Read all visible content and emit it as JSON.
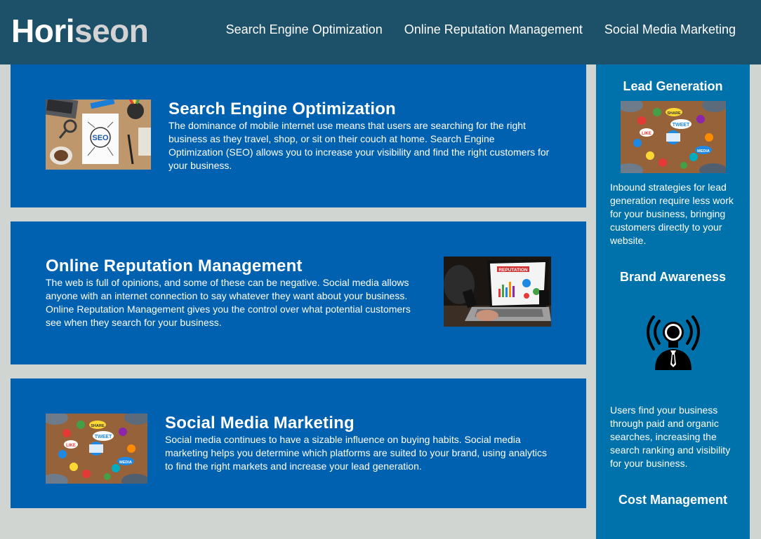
{
  "header": {
    "logo_main": "Hori",
    "logo_accent": "seon",
    "nav": [
      {
        "label": "Search Engine Optimization"
      },
      {
        "label": "Online Reputation Management"
      },
      {
        "label": "Social Media Marketing"
      }
    ]
  },
  "content": [
    {
      "title": "Search Engine Optimization",
      "text": "The dominance of mobile internet use means that users are searching for the right business as they travel, shop, or sit on their couch at home. Search Engine Optimization (SEO) allows you to increase your visibility and find the right customers for your business.",
      "image_label": "SEO"
    },
    {
      "title": "Online Reputation Management",
      "text": "The web is full of opinions, and some of these can be negative. Social media allows anyone with an internet connection to say whatever they want about your business. Online Reputation Management gives you the control over what potential customers see when they search for your business.",
      "image_label": "REPUTATION"
    },
    {
      "title": "Social Media Marketing",
      "text": "Social media continues to have a sizable influence on buying habits. Social media marketing helps you determine which platforms are suited to your brand, using analytics to find the right markets and increase your lead generation.",
      "image_badges": [
        "TWEET",
        "LIKE",
        "SHARE",
        "MEDIA"
      ]
    }
  ],
  "sidebar": [
    {
      "title": "Lead Generation",
      "text": "Inbound strategies for lead generation require less work for your business, bringing customers directly to your website.",
      "image_badges": [
        "TWEET",
        "LIKE",
        "SHARE",
        "MEDIA"
      ]
    },
    {
      "title": "Brand Awareness",
      "text": "Users find your business through paid and organic searches, increasing the search ranking and visibility for your business."
    },
    {
      "title": "Cost Management"
    }
  ],
  "colors": {
    "header": "#1d5069",
    "page_background": "#d1d5d1",
    "content_panel": "#0061b0",
    "sidebar": "#0072ab"
  }
}
